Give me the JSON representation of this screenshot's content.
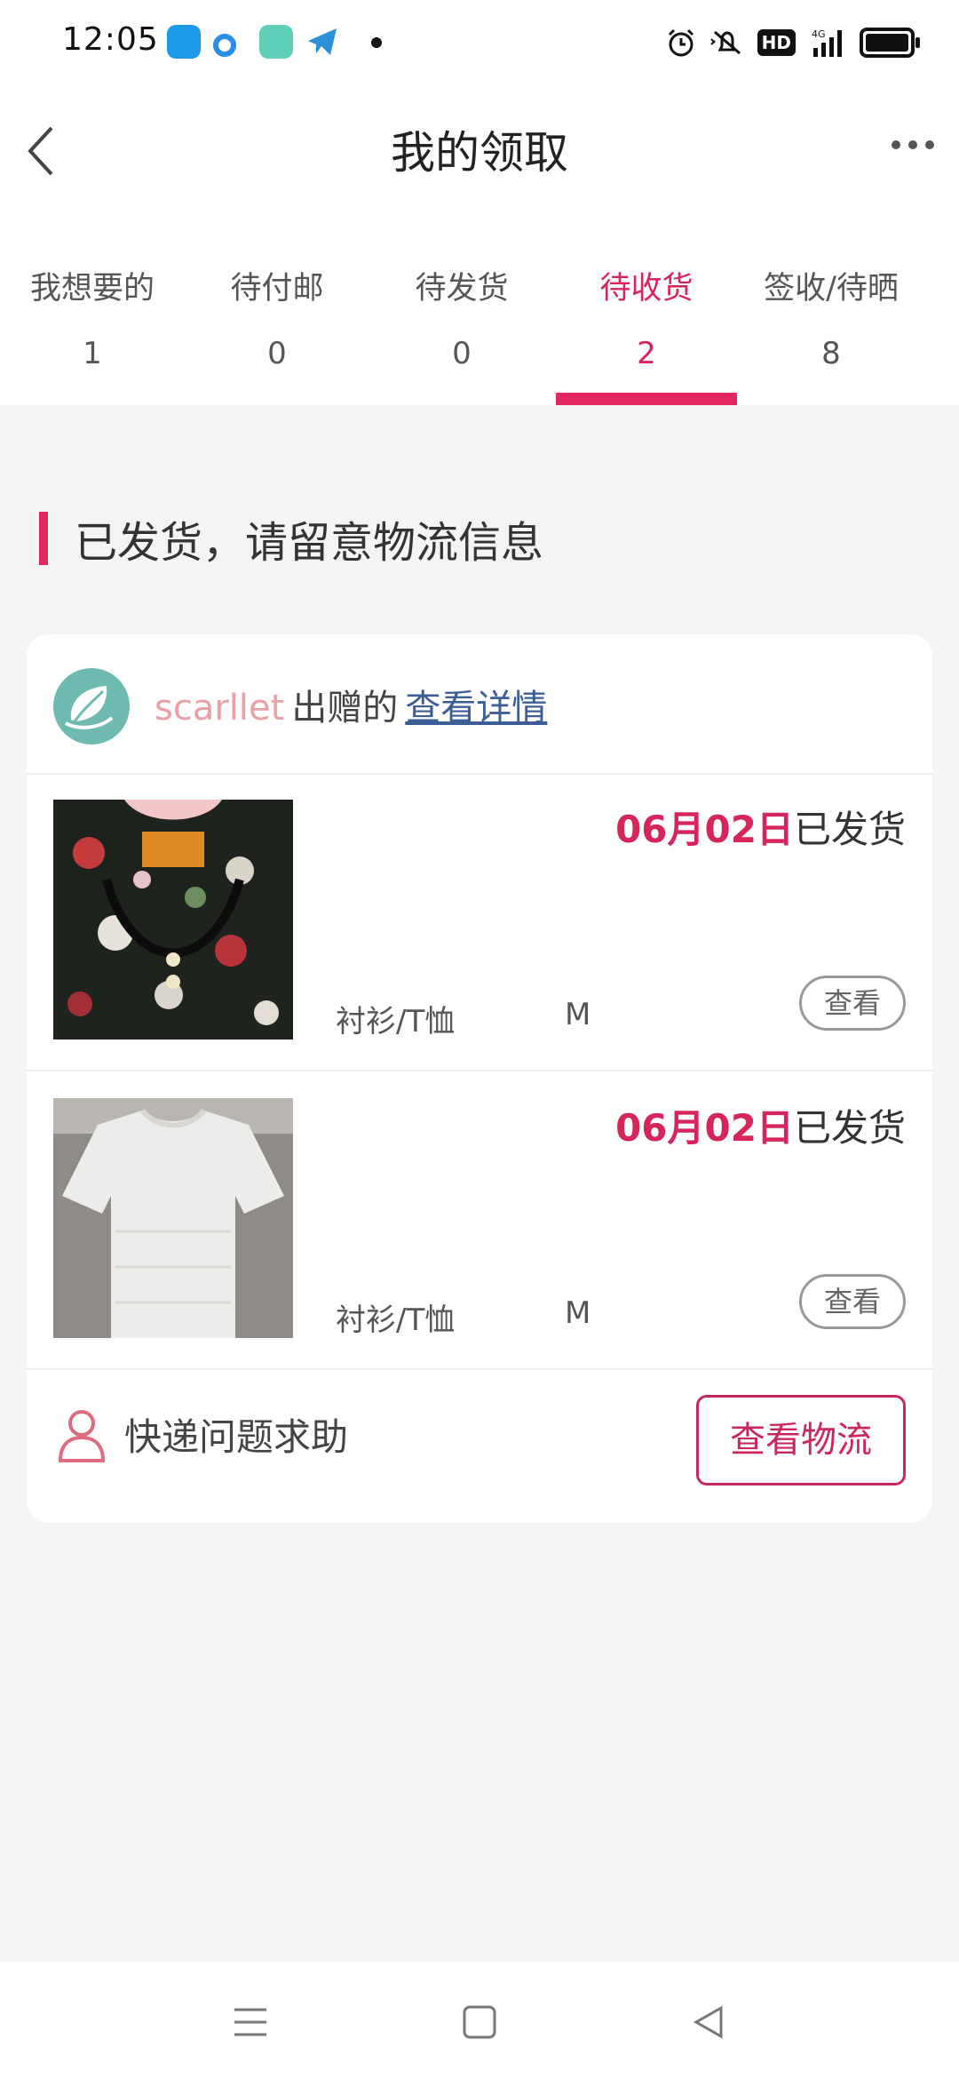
{
  "status_bar": {
    "time": "12:05",
    "network": "4G",
    "hd": "HD",
    "app_icons": [
      "bilibili-like-icon",
      "browser-icon",
      "messenger-icon",
      "telegram-icon"
    ]
  },
  "header": {
    "title": "我的领取",
    "back_icon": "chevron-left-icon",
    "more_icon": "more-horizontal-icon"
  },
  "tabs": [
    {
      "label": "我想要的",
      "count": "1",
      "active": false
    },
    {
      "label": "待付邮",
      "count": "0",
      "active": false
    },
    {
      "label": "待发货",
      "count": "0",
      "active": false
    },
    {
      "label": "待收货",
      "count": "2",
      "active": true
    },
    {
      "label": "签收/待晒",
      "count": "8",
      "active": false
    }
  ],
  "section": {
    "title": "已发货，请留意物流信息"
  },
  "order": {
    "giver_name": "scarllet",
    "giver_verb": "出赠的",
    "detail_link": "查看详情",
    "items": [
      {
        "ship_date": "06月02日",
        "ship_status": "已发货",
        "category": "衬衫/T恤",
        "size": "M",
        "view_label": "查看",
        "photo": "floral-blouse"
      },
      {
        "ship_date": "06月02日",
        "ship_status": "已发货",
        "category": "衬衫/T恤",
        "size": "M",
        "view_label": "查看",
        "photo": "white-lace-top"
      }
    ],
    "help_label": "快递问题求助",
    "track_label": "查看物流"
  },
  "colors": {
    "accent": "#e3285f",
    "link": "#3c5e96",
    "giver_name": "#eaa0a7",
    "background": "#f4f4f4"
  }
}
